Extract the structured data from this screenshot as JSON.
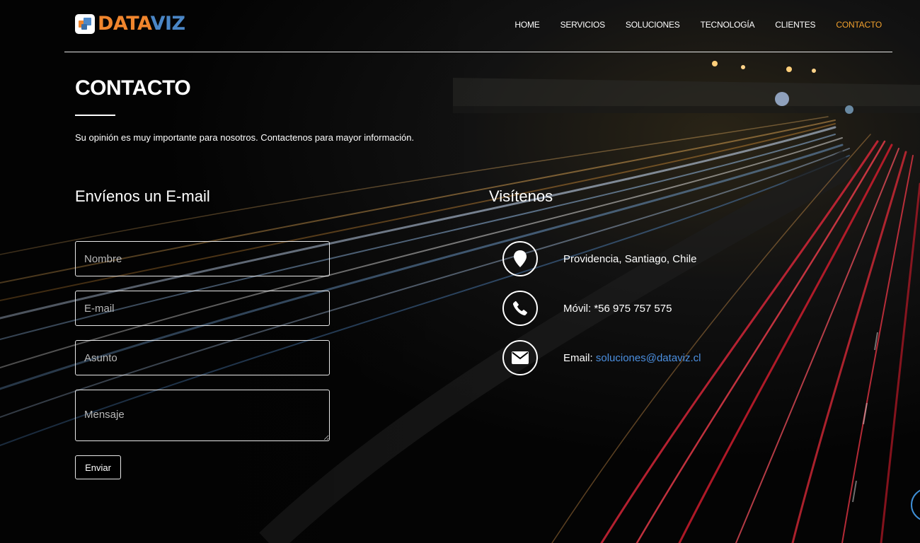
{
  "brand": {
    "name_part1": "DATA",
    "name_part2": "VIZ",
    "color_primary": "#f0852d",
    "color_secondary": "#4a86c6"
  },
  "nav": {
    "items": [
      {
        "label": "HOME",
        "active": false
      },
      {
        "label": "SERVICIOS",
        "active": false
      },
      {
        "label": "SOLUCIONES",
        "active": false
      },
      {
        "label": "TECNOLOGÍA",
        "active": false
      },
      {
        "label": "CLIENTES",
        "active": false
      },
      {
        "label": "CONTACTO",
        "active": true
      }
    ],
    "active_color": "#f0a02d"
  },
  "page": {
    "title": "CONTACTO",
    "subtitle": "Su opinión es muy importante para nosotros. Contactenos para mayor información."
  },
  "form": {
    "heading": "Envíenos un E-mail",
    "name_placeholder": "Nombre",
    "email_placeholder": "E-mail",
    "subject_placeholder": "Asunto",
    "message_placeholder": "Mensaje",
    "submit_label": "Enviar"
  },
  "visit": {
    "heading": "Visítenos",
    "address": "Providencia, Santiago, Chile",
    "phone_label": "Móvil:",
    "phone": "*56 975 757 575",
    "email_label": "Email:",
    "email": "soluciones@dataviz.cl",
    "link_color": "#4b8fe0"
  },
  "icons": {
    "address": "map-marker-icon",
    "phone": "phone-icon",
    "email": "envelope-icon",
    "chat": "chat-bubble-icon"
  }
}
